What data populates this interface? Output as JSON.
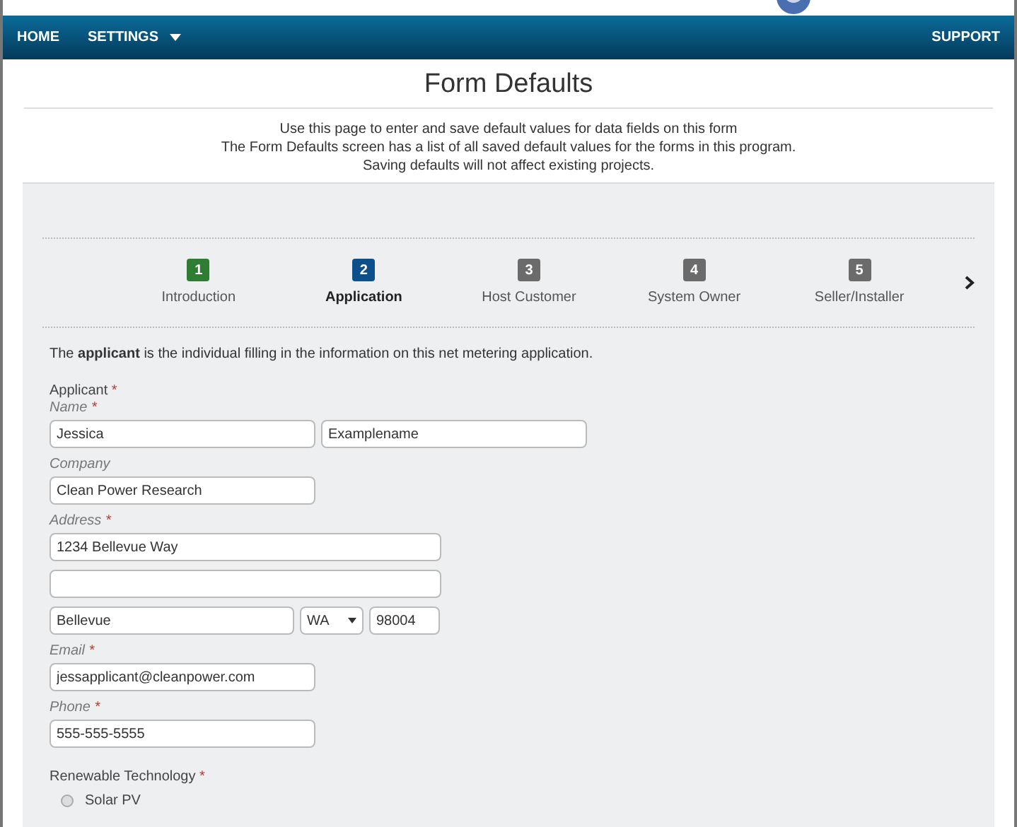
{
  "navbar": {
    "items": [
      {
        "label": "HOME",
        "kind": "link"
      },
      {
        "label": "SETTINGS",
        "kind": "dropdown"
      }
    ],
    "right": {
      "label": "SUPPORT"
    }
  },
  "title": "Form Defaults",
  "intro": [
    "Use this page to enter and save default values for data fields on this form",
    "The Form Defaults screen has a list of all saved default values for the forms in this program.",
    "Saving defaults will not affect existing projects."
  ],
  "steps": [
    {
      "number": "1",
      "label": "Introduction",
      "color": "#2e7d32",
      "selected": false
    },
    {
      "number": "2",
      "label": "Application",
      "color": "#0d4f8b",
      "selected": true
    },
    {
      "number": "3",
      "label": "Host Customer",
      "color": "#6b6b6b",
      "selected": false
    },
    {
      "number": "4",
      "label": "System Owner",
      "color": "#6b6b6b",
      "selected": false
    },
    {
      "number": "5",
      "label": "Seller/Installer",
      "color": "#6b6b6b",
      "selected": false
    }
  ],
  "description": "The **applicant** is the individual filling in the information on this net metering application.",
  "section": {
    "label": "Applicant",
    "mark": "*"
  },
  "groups": [
    {
      "label": "Name",
      "mark": "*",
      "rows": [
        [
          {
            "kind": "text",
            "value": "Jessica"
          },
          {
            "kind": "text",
            "value": "Examplename"
          }
        ]
      ]
    },
    {
      "label": "Company",
      "rows": [
        [
          {
            "kind": "text",
            "value": "Clean Power Research"
          }
        ]
      ]
    },
    {
      "label": "Address",
      "mark": "*",
      "rows": [
        [
          {
            "kind": "text",
            "value": "1234 Bellevue Way"
          }
        ],
        [
          {
            "kind": "text"
          }
        ],
        [
          {
            "kind": "text",
            "value": "Bellevue"
          },
          {
            "kind": "select",
            "value": "WA"
          },
          {
            "kind": "text",
            "value": "98004"
          }
        ]
      ]
    },
    {
      "label": "Email",
      "mark": "*",
      "rows": [
        [
          {
            "kind": "text",
            "value": "jessapplicant@cleanpower.com"
          }
        ]
      ]
    },
    {
      "label": "Phone",
      "mark": "*",
      "rows": [
        [
          {
            "kind": "text",
            "value": "555-555-5555"
          }
        ]
      ]
    }
  ],
  "technology": {
    "label": "Renewable Technology",
    "mark": "*",
    "options": [
      {
        "label": "Solar PV",
        "checked": false
      }
    ]
  }
}
